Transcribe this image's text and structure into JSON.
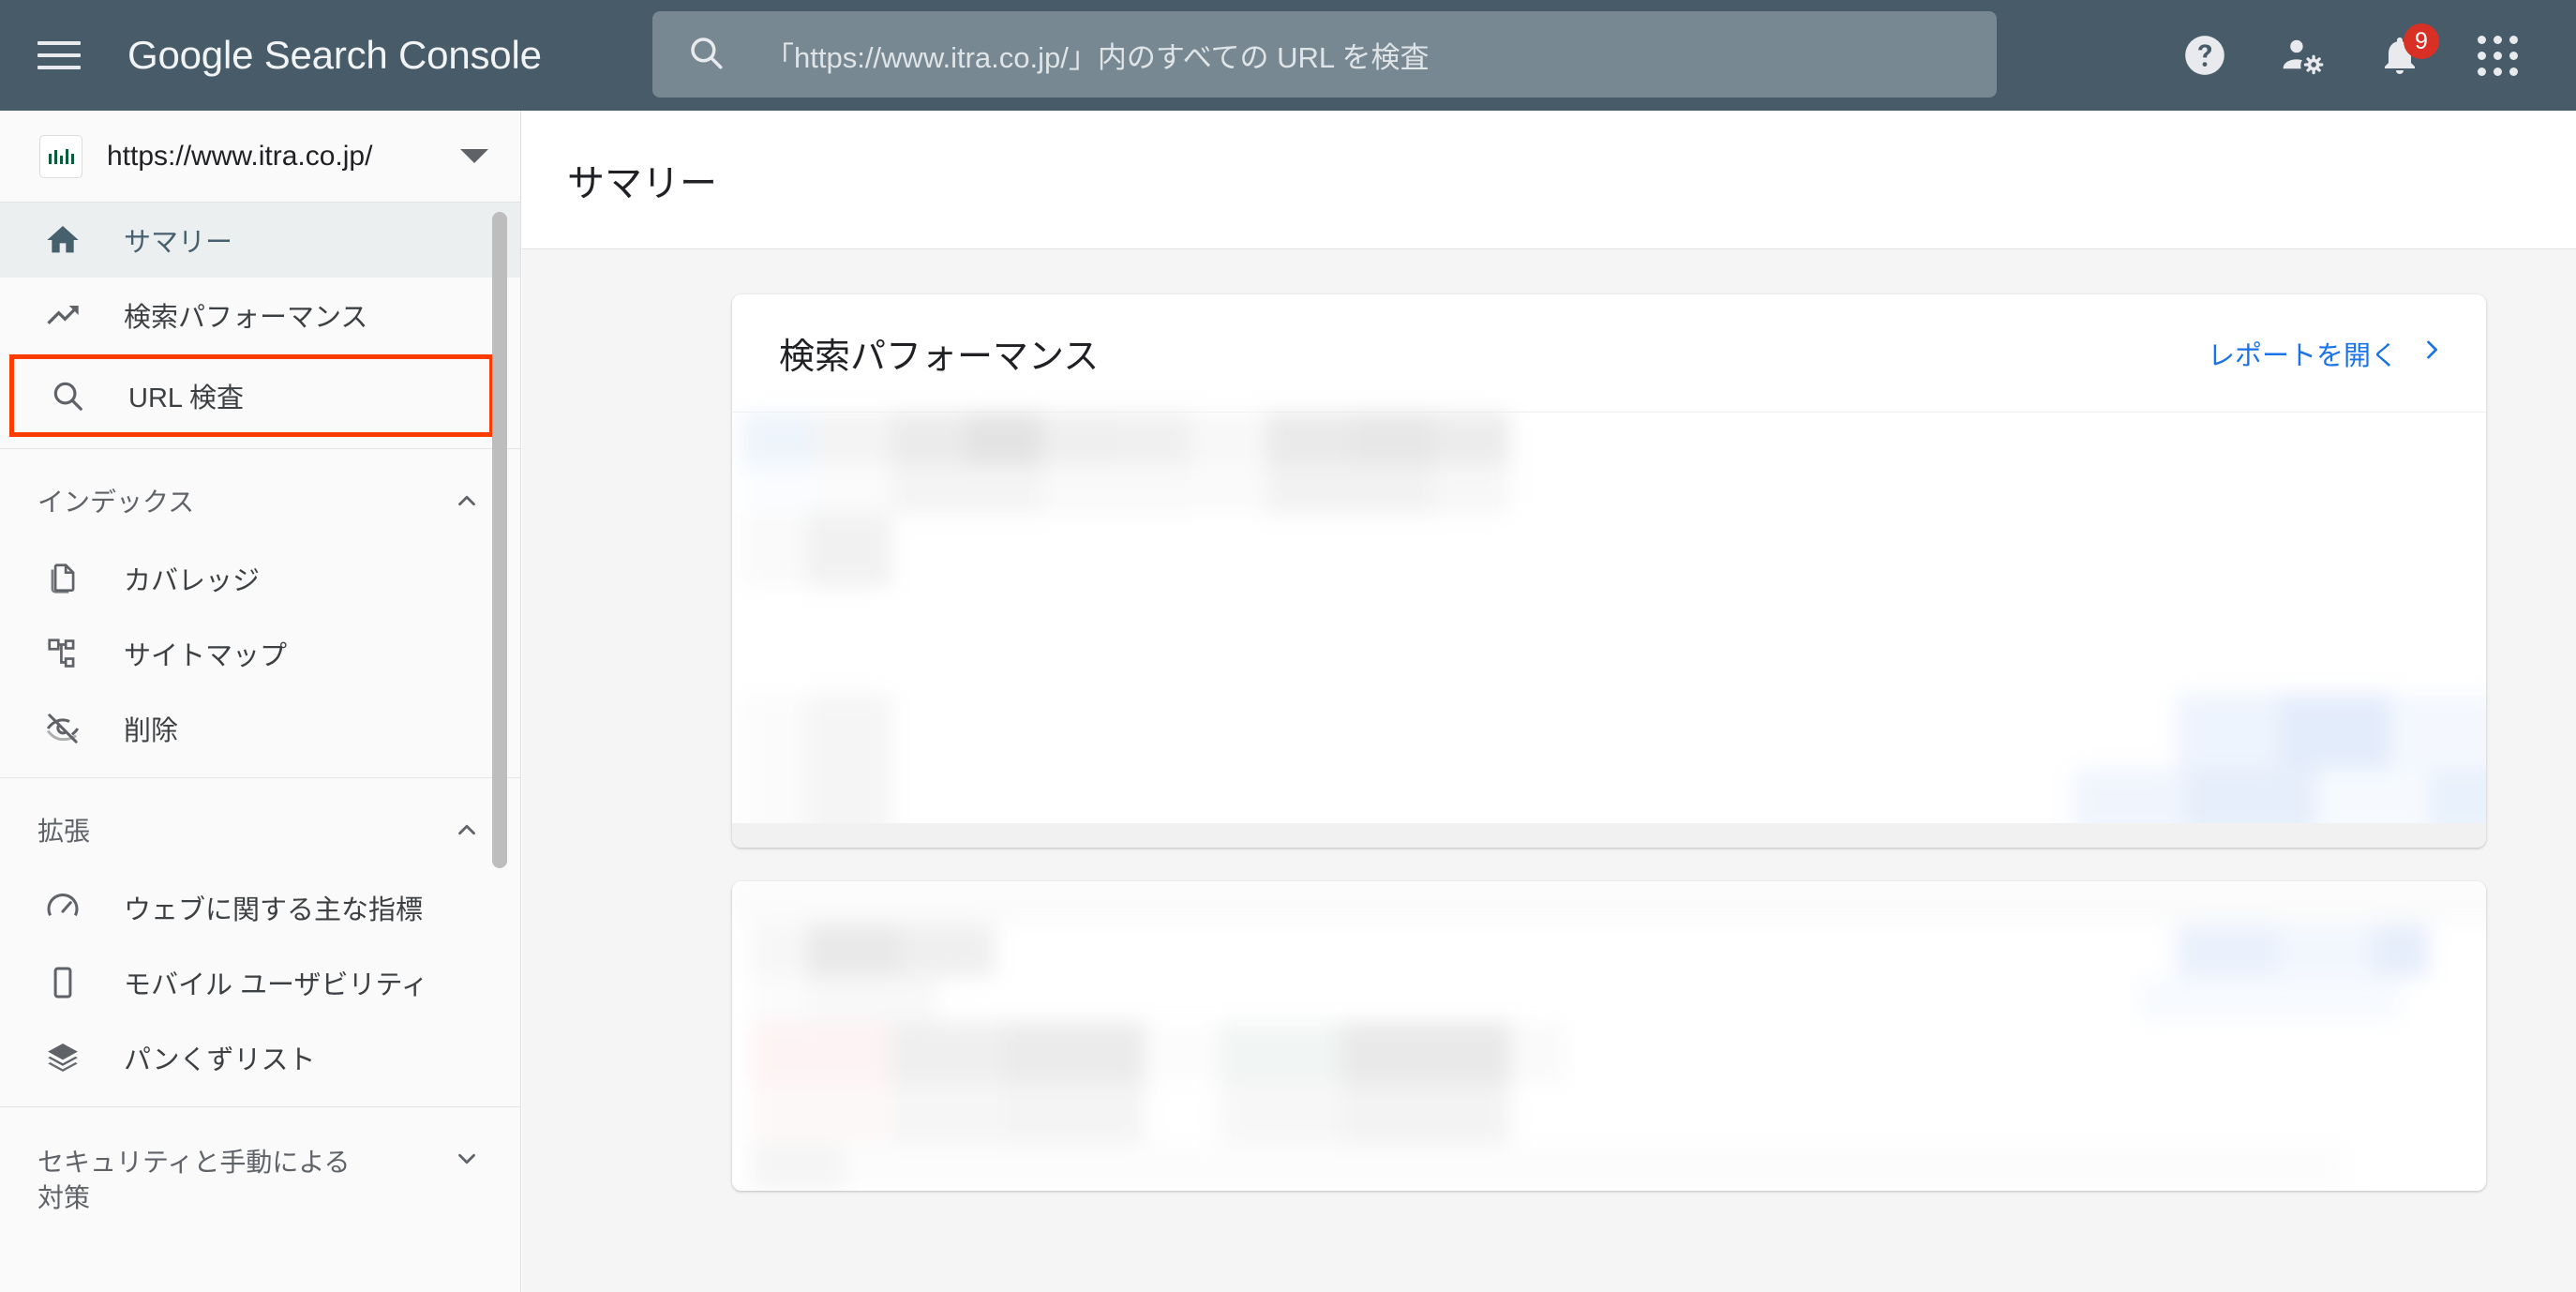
{
  "topbar": {
    "menu_icon": "hamburger-menu-icon",
    "brand": "Google Search Console",
    "search": {
      "icon": "search-icon",
      "placeholder": "「https://www.itra.co.jp/」内のすべての URL を検査",
      "value": ""
    },
    "actions": [
      {
        "name": "help-icon",
        "label": "ヘルプ"
      },
      {
        "name": "account-settings-icon",
        "label": "アカウント設定"
      },
      {
        "name": "notifications-bell-icon",
        "label": "通知",
        "badge": "9"
      },
      {
        "name": "google-apps-icon",
        "label": "Google アプリ"
      }
    ]
  },
  "sidebar": {
    "property": {
      "icon": "property-bars-icon",
      "value": "https://www.itra.co.jp/",
      "dropdown_icon": "dropdown-caret-icon"
    },
    "items": [
      {
        "label": "サマリー",
        "icon": "home-icon",
        "active": true
      },
      {
        "label": "検索パフォーマンス",
        "icon": "trending-up-icon",
        "active": false
      },
      {
        "label": "URL 検査",
        "icon": "search-icon",
        "active": false,
        "highlighted": true
      }
    ],
    "sections": [
      {
        "title": "インデックス",
        "chevron": "chevron-up-icon",
        "items": [
          {
            "label": "カバレッジ",
            "icon": "pages-copy-icon"
          },
          {
            "label": "サイトマップ",
            "icon": "sitemap-tree-icon"
          },
          {
            "label": "削除",
            "icon": "eye-off-icon"
          }
        ]
      },
      {
        "title": "拡張",
        "chevron": "chevron-up-icon",
        "items": [
          {
            "label": "ウェブに関する主な指標",
            "icon": "speedometer-icon"
          },
          {
            "label": "モバイル ユーザビリティ",
            "icon": "mobile-phone-icon"
          },
          {
            "label": "パンくずリスト",
            "icon": "layers-icon"
          }
        ]
      },
      {
        "title": "セキュリティと手動による対策",
        "chevron": "chevron-down-icon",
        "items": []
      }
    ],
    "scrollbar": "sidebar-scrollbar"
  },
  "main": {
    "page_title": "サマリー",
    "cards": [
      {
        "title": "検索パフォーマンス",
        "link_label": "レポートを開く",
        "link_icon": "chevron-right-icon",
        "content_state": "blurred"
      },
      {
        "title": "",
        "link_label": "",
        "content_state": "blurred"
      }
    ]
  },
  "colors": {
    "topbar_bg": "#475b68",
    "search_bg": "#778892",
    "badge_red": "#d93025",
    "link_blue": "#1a73e8",
    "highlight_box": "#fb3b00",
    "active_nav": "#47606e",
    "canvas_bg": "#f5f5f5"
  },
  "chart_data": {
    "type": "area",
    "title": "検索パフォーマンス",
    "state": "blurred-anonymised",
    "xlabel": "",
    "ylabel": "",
    "categories": [],
    "values": [],
    "note": "グラフ内容はぼかし処理されており判読不能"
  }
}
